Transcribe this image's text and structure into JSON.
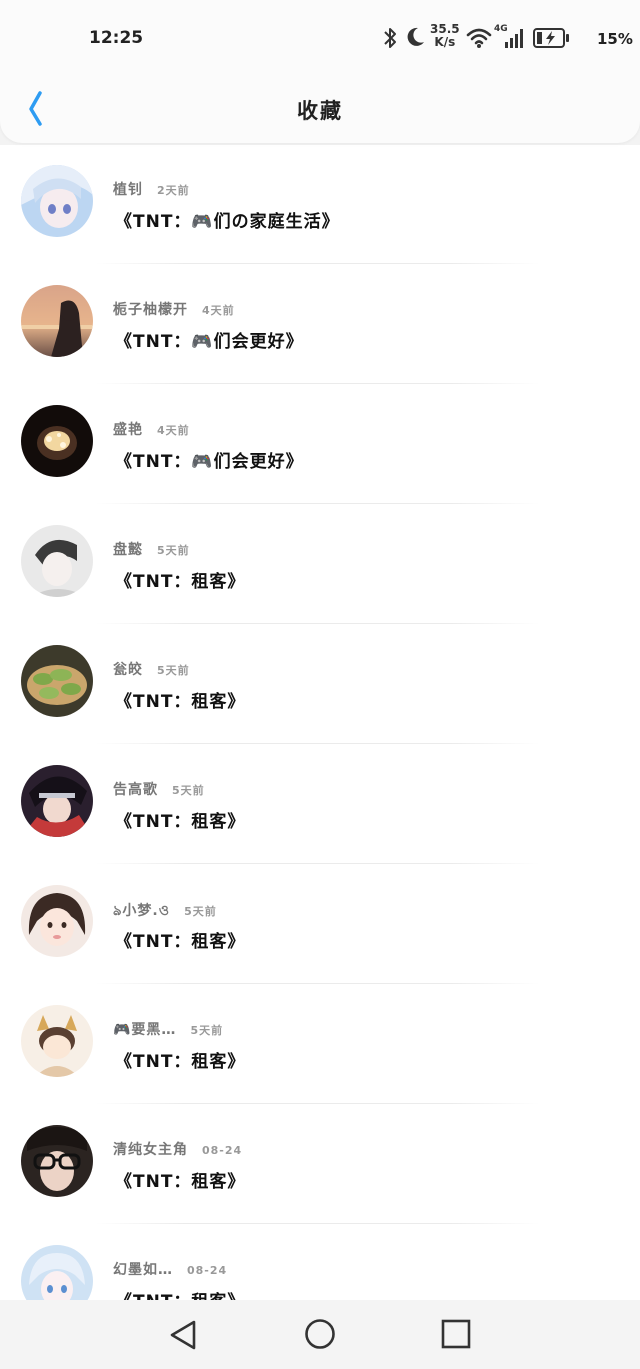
{
  "status_bar": {
    "time": "12:25",
    "net_speed_value": "35.5",
    "net_speed_unit": "K/s",
    "network_type": "4G",
    "battery_percent": "15%",
    "icons": [
      "bluetooth-icon",
      "moon-icon",
      "wifi-icon",
      "signal-icon",
      "battery-charging-icon"
    ]
  },
  "header": {
    "title": "收藏",
    "back_icon": "chevron-left-icon"
  },
  "favorites": [
    {
      "username": "植钊",
      "time": "2天前",
      "title": "《TNT：🎮们の家庭生活》"
    },
    {
      "username": "栀子柚檬开",
      "time": "4天前",
      "title": "《TNT：🎮们会更好》"
    },
    {
      "username": "盛艳",
      "time": "4天前",
      "title": "《TNT：🎮们会更好》"
    },
    {
      "username": "盘懿",
      "time": "5天前",
      "title": "《TNT：租客》"
    },
    {
      "username": "瓮皎",
      "time": "5天前",
      "title": "《TNT：租客》"
    },
    {
      "username": "告高歌",
      "time": "5天前",
      "title": "《TNT：租客》"
    },
    {
      "username": "ঌ小梦.ও",
      "time": "5天前",
      "title": "《TNT：租客》"
    },
    {
      "username": "🎮要黑…",
      "time": "5天前",
      "title": "《TNT：租客》"
    },
    {
      "username": "清纯女主角",
      "time": "08-24",
      "title": "《TNT：租客》"
    },
    {
      "username": "幻墨如…",
      "time": "08-24",
      "title": "《TNT：租客》"
    }
  ],
  "nav_bar": {
    "icons": [
      "back-triangle-icon",
      "home-circle-icon",
      "recents-square-icon"
    ]
  },
  "colors": {
    "accent": "#2e9cf2",
    "background": "#ffffff",
    "header_bg": "#fbfbfb"
  }
}
